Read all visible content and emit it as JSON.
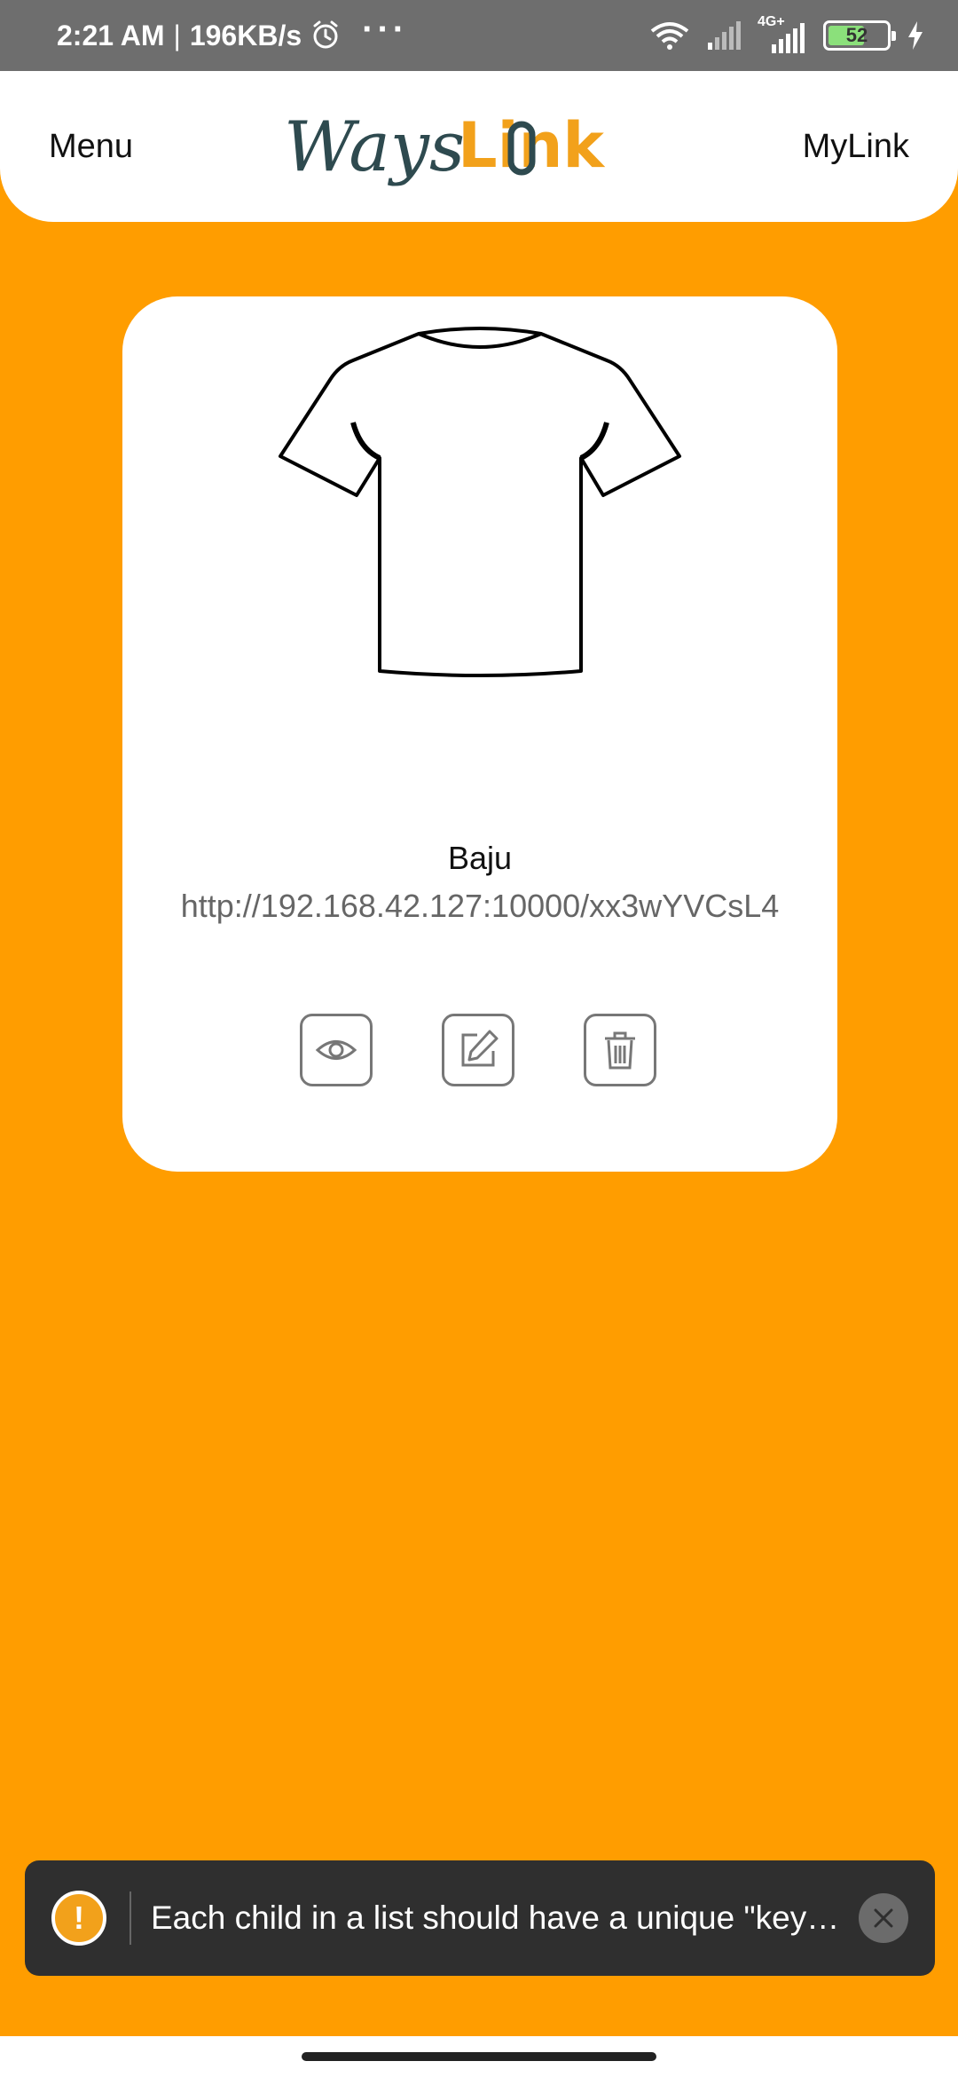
{
  "status_bar": {
    "time": "2:21 AM",
    "separator": "|",
    "speed": "196KB/s",
    "more": "···",
    "network": "4G+",
    "battery_level": "52"
  },
  "header": {
    "menu_label": "Menu",
    "logo_text_left": "Ways",
    "logo_text_right": "Link",
    "mylink_label": "MyLink"
  },
  "card": {
    "title": "Baju",
    "url": "http://192.168.42.127:10000/xx3wYVCsL4",
    "image_icon": "tshirt-outline",
    "actions": [
      {
        "name": "view",
        "icon": "eye-icon"
      },
      {
        "name": "edit",
        "icon": "edit-icon"
      },
      {
        "name": "delete",
        "icon": "trash-icon"
      }
    ]
  },
  "toast": {
    "icon_label": "!",
    "message": "Each child in a list should have a unique \"key\" prop."
  },
  "colors": {
    "background": "#FF9D00",
    "accent": "#F2A11B",
    "logo_dark": "#2E4A4F",
    "toast_bg": "#2F2F2F"
  }
}
